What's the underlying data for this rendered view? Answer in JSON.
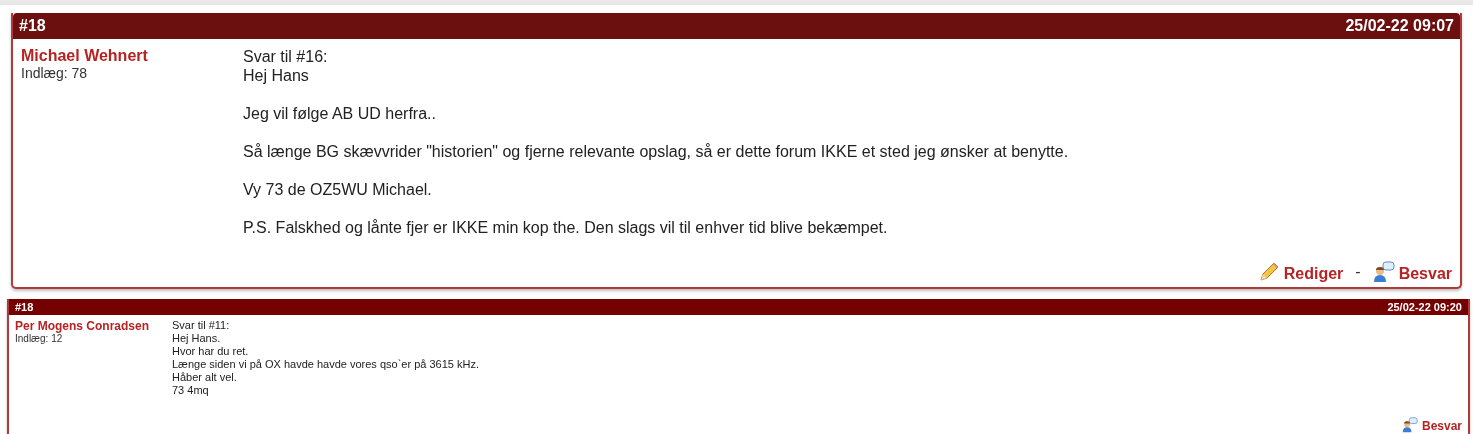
{
  "posts": [
    {
      "kind": "large",
      "number": "#18",
      "timestamp": "25/02-22 09:07",
      "author": "Michael Wehnert",
      "post_count": "Indlæg: 78",
      "paragraphs": [
        [
          "Svar til #16:",
          "Hej Hans"
        ],
        [
          "Jeg vil følge AB UD herfra.."
        ],
        [
          "Så længe BG skævvrider \"historien\" og fjerne relevante opslag, så er dette forum IKKE et sted jeg ønsker at benytte."
        ],
        [
          "Vy 73 de OZ5WU Michael."
        ],
        [
          "P.S. Falskhed og lånte fjer er IKKE min kop the. Den slags vil til enhver tid blive bekæmpet."
        ]
      ],
      "actions": [
        {
          "kind": "edit",
          "label": "Rediger"
        },
        {
          "kind": "separator",
          "label": "-"
        },
        {
          "kind": "reply",
          "label": "Besvar"
        }
      ]
    },
    {
      "kind": "small",
      "number": "#18",
      "timestamp": "25/02-22 09:20",
      "author": "Per Mogens Conradsen",
      "post_count": "Indlæg: 12",
      "paragraphs": [
        [
          "Svar til #11:",
          "Hej Hans.",
          "Hvor har du ret.",
          "Længe siden vi på OX havde havde vores qso`er på 3615 kHz.",
          "Håber alt vel.",
          "73 4mq"
        ]
      ],
      "actions": [
        {
          "kind": "reply",
          "label": "Besvar"
        }
      ]
    }
  ]
}
